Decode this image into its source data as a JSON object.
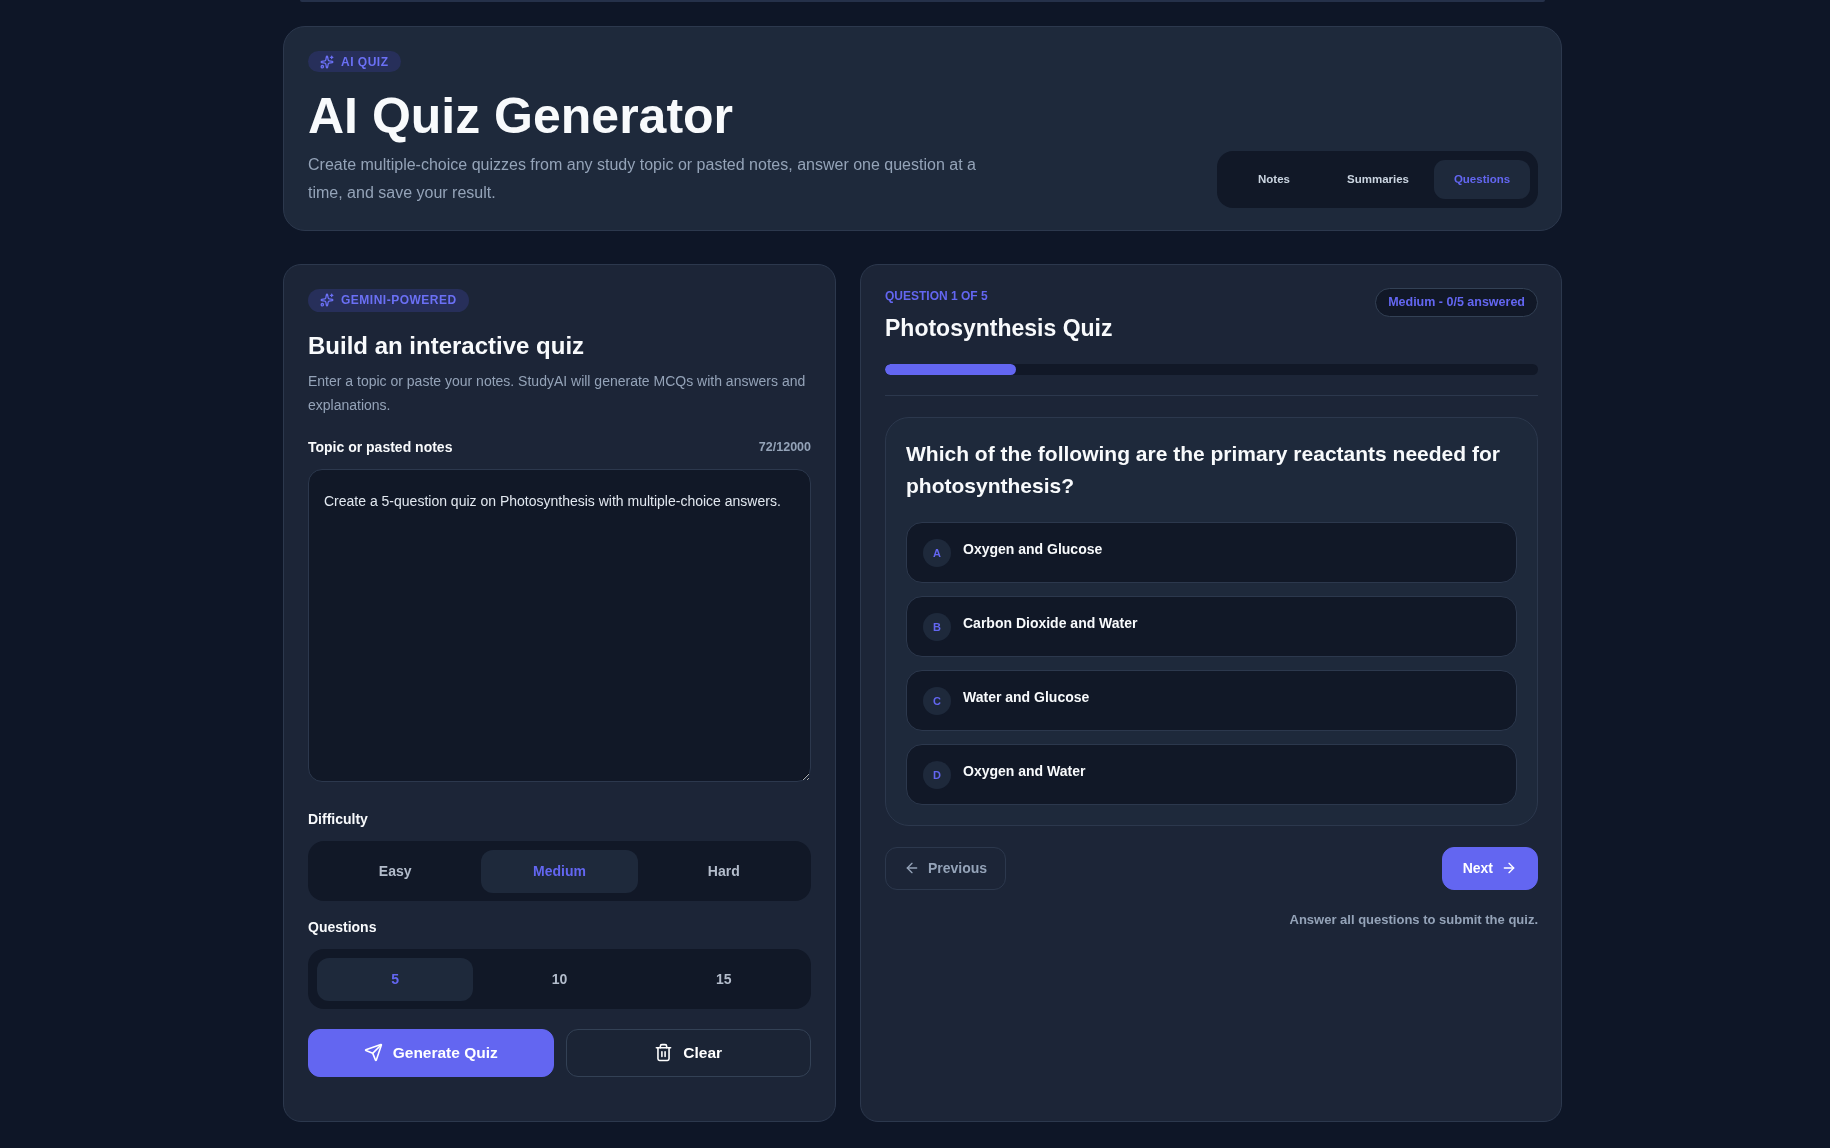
{
  "header": {
    "badge": "AI QUIZ",
    "title": "AI Quiz Generator",
    "description": "Create multiple-choice quizzes from any study topic or pasted notes, answer one question at a time, and save your result.",
    "tabs": [
      {
        "label": "Notes",
        "selected": false
      },
      {
        "label": "Summaries",
        "selected": false
      },
      {
        "label": "Questions",
        "selected": true
      }
    ]
  },
  "builder": {
    "badge": "GEMINI-POWERED",
    "title": "Build an interactive quiz",
    "description": "Enter a topic or paste your notes. StudyAI will generate MCQs with answers and explanations.",
    "notes_field": {
      "label": "Topic or pasted notes",
      "counter": "72/12000",
      "value": "Create a 5-question quiz on Photosynthesis with multiple-choice answers."
    },
    "difficulty": {
      "label": "Difficulty",
      "options": [
        {
          "label": "Easy",
          "selected": false
        },
        {
          "label": "Medium",
          "selected": true
        },
        {
          "label": "Hard",
          "selected": false
        }
      ]
    },
    "question_count": {
      "label": "Questions",
      "options": [
        {
          "label": "5",
          "selected": true
        },
        {
          "label": "10",
          "selected": false
        },
        {
          "label": "15",
          "selected": false
        }
      ]
    },
    "buttons": [
      {
        "kind": "generate",
        "label": "Generate Quiz"
      },
      {
        "kind": "clear",
        "label": "Clear"
      }
    ]
  },
  "quiz": {
    "eyebrow": "QUESTION 1 OF 5",
    "title": "Photosynthesis Quiz",
    "status": "Medium - 0/5 answered",
    "progress": {
      "level": 0.2
    },
    "question": {
      "text": "Which of the following are the primary reactants needed for photosynthesis?",
      "options": [
        {
          "letter": "A",
          "text": "Oxygen and Glucose",
          "selected": false
        },
        {
          "letter": "B",
          "text": "Carbon Dioxide and Water",
          "selected": false
        },
        {
          "letter": "C",
          "text": "Water and Glucose",
          "selected": false
        },
        {
          "letter": "D",
          "text": "Oxygen and Water",
          "selected": false
        }
      ]
    },
    "previous_button": {
      "label": "Previous",
      "disabled": true
    },
    "next_button": {
      "label": "Next",
      "disabled": false
    },
    "hint": "Answer all questions to submit the quiz."
  }
}
